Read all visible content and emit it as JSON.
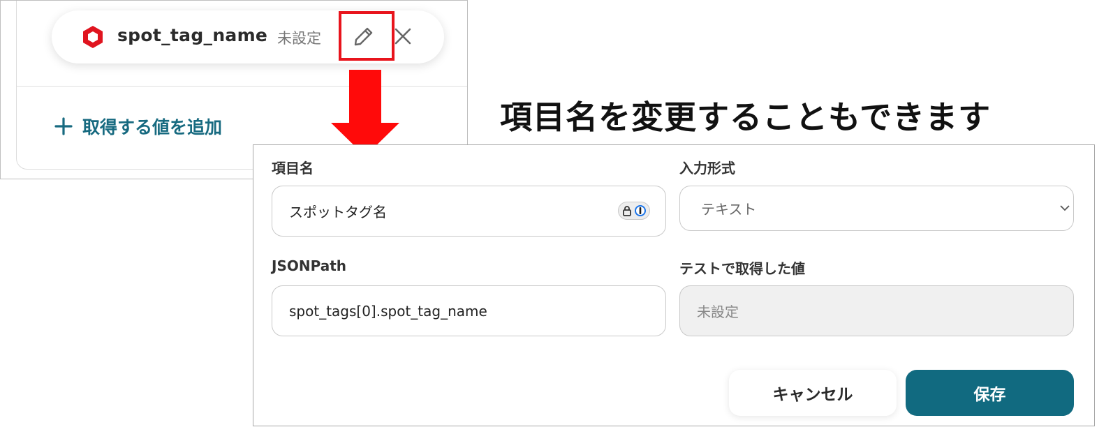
{
  "field_card": {
    "tag_name": "spot_tag_name",
    "status": "未設定",
    "add_value_label": "取得する値を追加"
  },
  "headline": "項目名を変更することもできます",
  "dialog": {
    "item_name": {
      "label": "項目名",
      "value": "スポットタグ名"
    },
    "input_format": {
      "label": "入力形式",
      "selected": "テキスト"
    },
    "json_path": {
      "label": "JSONPath",
      "value": "spot_tags[0].spot_tag_name"
    },
    "test_value": {
      "label": "テストで取得した値",
      "value": "未設定"
    },
    "cancel_label": "キャンセル",
    "save_label": "保存"
  },
  "colors": {
    "accent": "#116a80",
    "highlight": "#e8141c",
    "brand_icon": "#e0141f"
  }
}
